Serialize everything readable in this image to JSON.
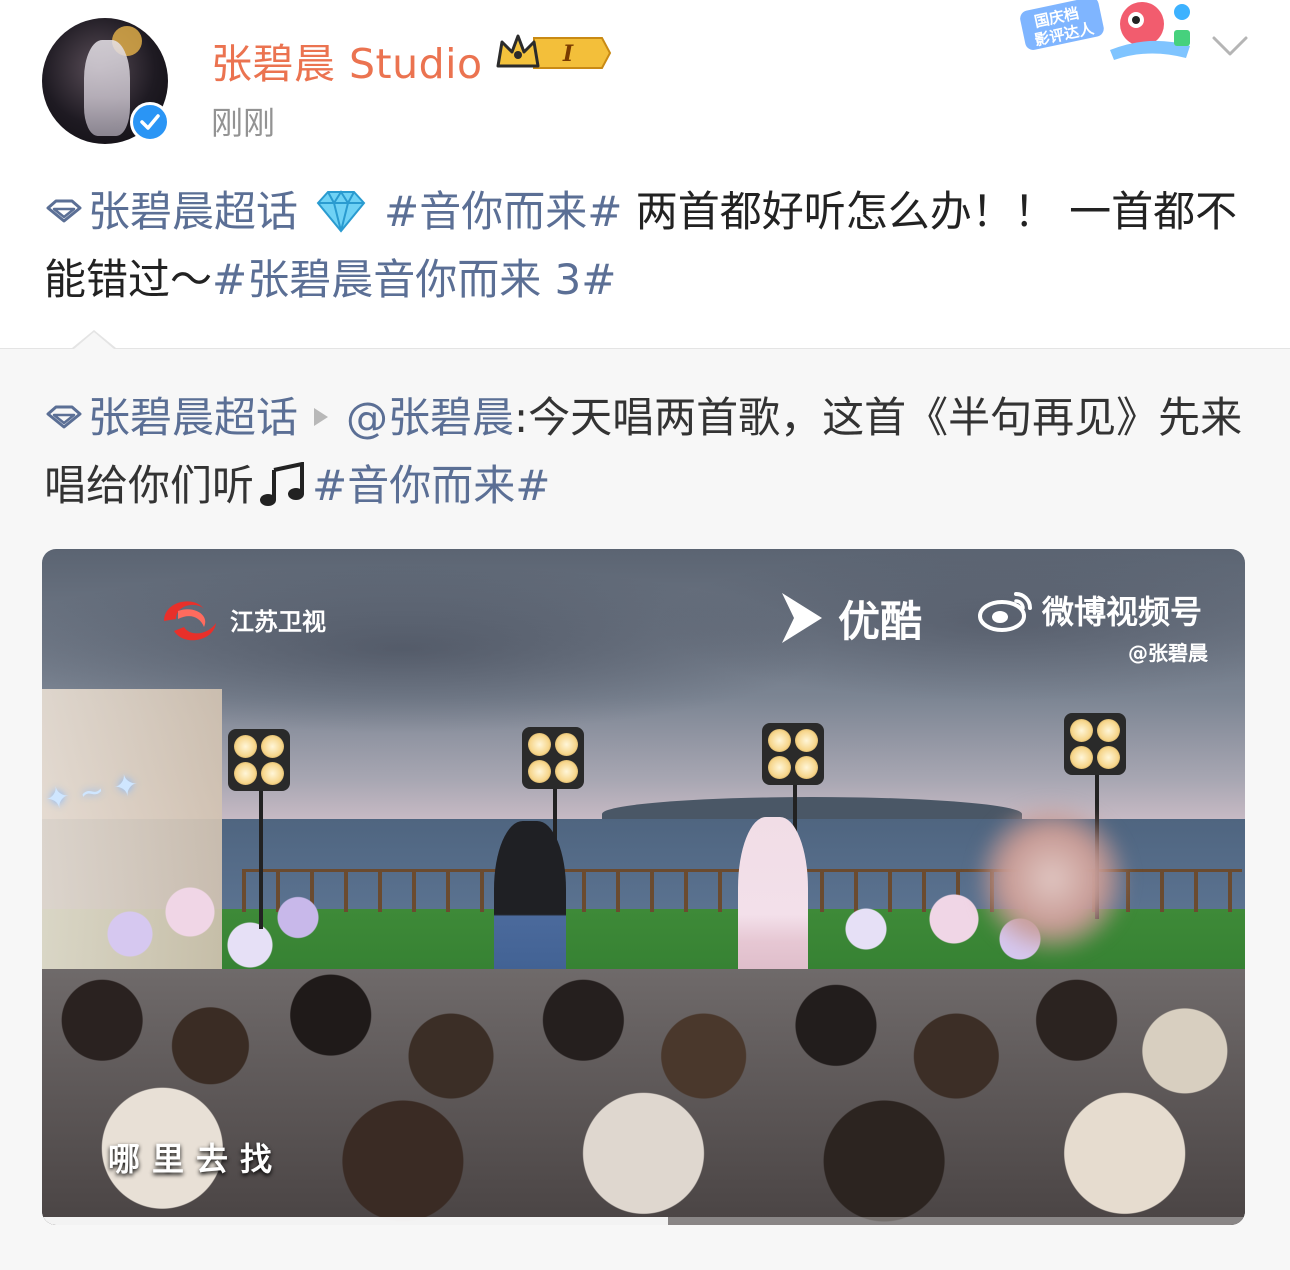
{
  "header": {
    "username": "张碧晨 Studio",
    "badge_level": "I",
    "post_time": "刚刚",
    "event_badge_text": "国庆档影评达人"
  },
  "post": {
    "supertopic_label": "张碧晨超话",
    "hashtag_1": "#音你而来#",
    "text_1": " 两首都好听怎么办！！ 一首都不能错过～",
    "hashtag_2": "#张碧晨音你而来 3#"
  },
  "repost": {
    "supertopic_label": "张碧晨超话",
    "mention": "@张碧晨",
    "text": ":今天唱两首歌，这首《半句再见》先来唱给你们听",
    "hashtag": "#音你而来#"
  },
  "video": {
    "channel_name": "江苏卫视",
    "youku_label": "优酷",
    "weibo_video_label": "微博视频号",
    "weibo_handle": "@张碧晨",
    "subtitle": "哪里去找",
    "progress": 0.52
  },
  "colors": {
    "username": "#eb7350",
    "link": "#5b6f95",
    "verified": "#2a95f5",
    "repost_bg": "#f7f7f7"
  },
  "icons": {
    "topic": "diamond-outline-icon",
    "gem": "gem-icon",
    "play": "play-arrow-icon",
    "music": "music-note-icon",
    "chevron": "chevron-down-icon"
  }
}
